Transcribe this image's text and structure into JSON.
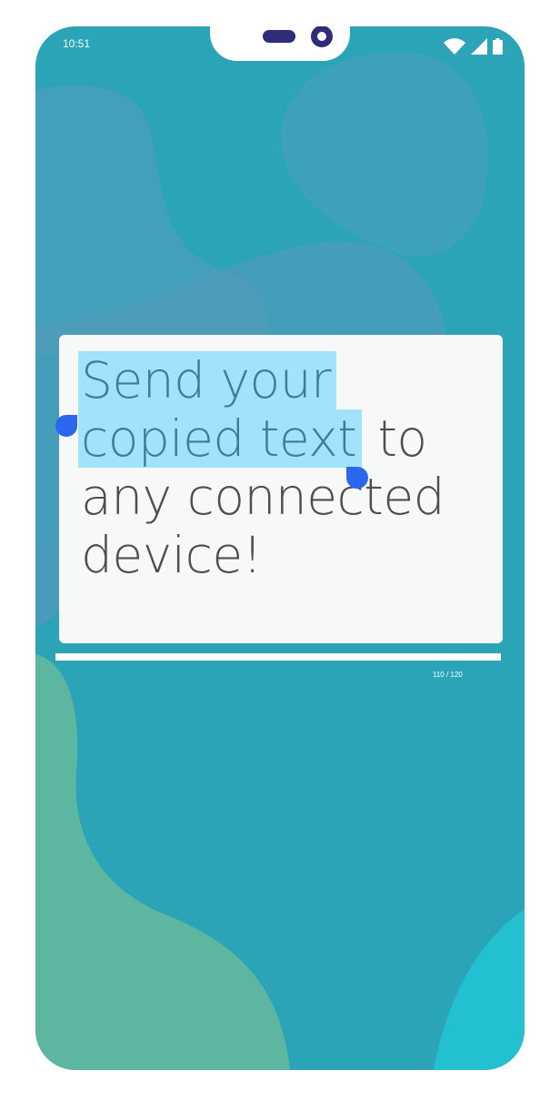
{
  "status_bar": {
    "time": "10:51",
    "icons": [
      "wifi-icon",
      "cellular-signal-icon",
      "battery-icon"
    ]
  },
  "card": {
    "lines": [
      {
        "selected": "Send your",
        "rest": ""
      },
      {
        "selected": "copied text",
        "rest": " to"
      },
      {
        "selected": "",
        "rest": "any connected"
      },
      {
        "selected": "",
        "rest": "device!"
      }
    ]
  },
  "counter": {
    "text": "110 / 120",
    "fill_fraction": 1.0
  },
  "colors": {
    "background": "#2ba4b8",
    "card": "#f7f9f9",
    "selection_highlight": "#a0e3fb",
    "selection_handle": "#2a66ee",
    "text": "#4e4e4e",
    "notch_accent": "#2f2d78"
  }
}
